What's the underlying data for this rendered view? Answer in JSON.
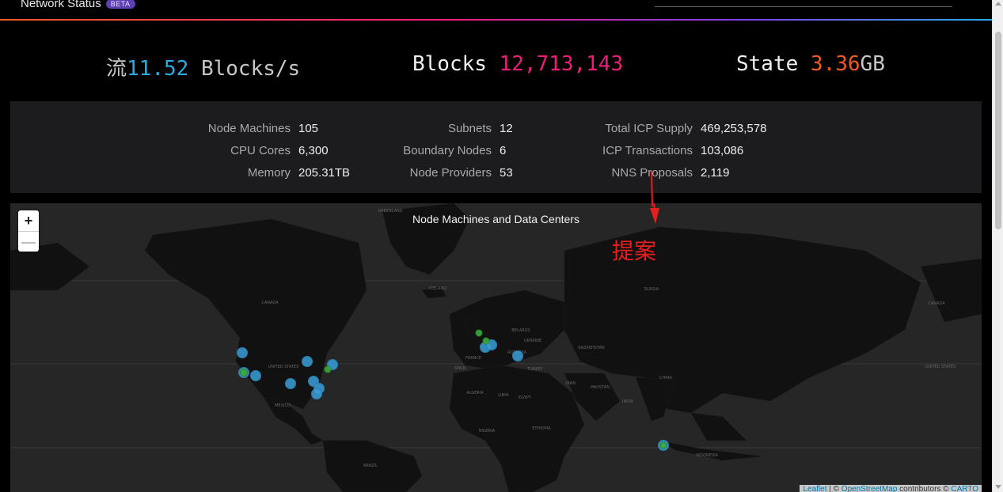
{
  "header": {
    "title": "Network Status",
    "badge": "BETA"
  },
  "stats": {
    "rate_prefix": "流",
    "rate_value": "11.52",
    "rate_unit": " Blocks/s",
    "blocks_label": "Blocks ",
    "blocks_value": "12,713,143",
    "state_label": "State ",
    "state_value": "3.36",
    "state_unit": "GB"
  },
  "panel": {
    "col1": [
      {
        "label": "Node Machines",
        "value": "105"
      },
      {
        "label": "CPU Cores",
        "value": "6,300"
      },
      {
        "label": "Memory",
        "value": "205.31",
        "unit": "TB"
      }
    ],
    "col2": [
      {
        "label": "Subnets",
        "value": "12"
      },
      {
        "label": "Boundary Nodes",
        "value": "6"
      },
      {
        "label": "Node Providers",
        "value": "53"
      }
    ],
    "col3": [
      {
        "label": "Total ICP Supply",
        "value": "469,253,578"
      },
      {
        "label": "ICP Transactions",
        "value": "103,086"
      },
      {
        "label": "NNS Proposals",
        "value": "2,119"
      }
    ]
  },
  "map": {
    "title": "Node Machines and Data Centers",
    "zoom_in": "+",
    "zoom_out": "—",
    "attribution_leaflet": "Leaflet",
    "attribution_sep1": " | © ",
    "attribution_osm": "OpenStreetMap",
    "attribution_mid": " contributors © ",
    "attribution_carto": "CARTO",
    "labels": [
      "GREENLAND",
      "CANADA",
      "UNITED STATES",
      "MEXICO",
      "RUSSIA",
      "CHINA",
      "INDIA",
      "BRAZIL",
      "KAZAKHSTAN",
      "TURKEY",
      "EGYPT",
      "LIBYA",
      "ALGERIA",
      "NIGERIA",
      "ETHIOPIA",
      "IRAN",
      "PAKISTAN",
      "FRANCE",
      "SPAIN",
      "ICELAND",
      "BELARUS",
      "UKRAINE",
      "ROMANIA",
      "CANADA",
      "UNITED STATES",
      "INDONESIA"
    ]
  },
  "annotation": {
    "text": "提案"
  },
  "colors": {
    "blue": "#29abe2",
    "pink": "#ed1e79",
    "orange": "#f15a24",
    "node_blue": "#3a9fd8",
    "node_green": "#3caa3c",
    "annotation_red": "#e81e1e"
  }
}
